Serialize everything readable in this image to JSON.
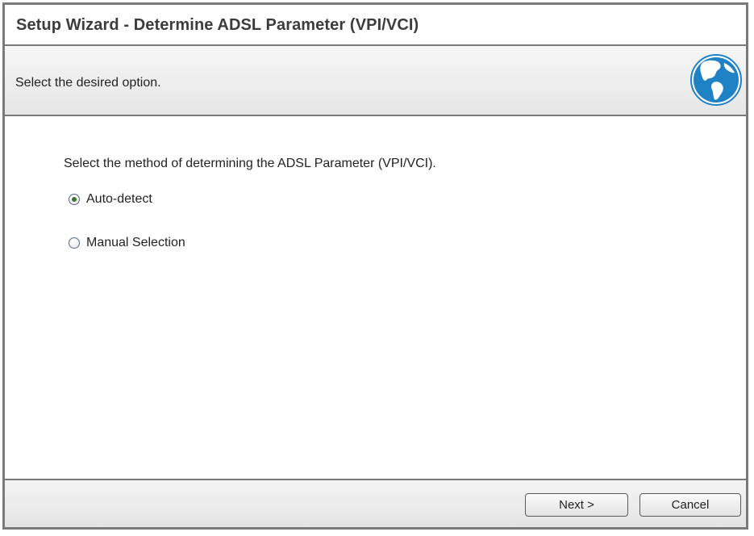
{
  "window": {
    "title": "Setup Wizard - Determine ADSL Parameter (VPI/VCI)"
  },
  "subheader": {
    "text": "Select the desired option.",
    "icon": "globe-icon"
  },
  "content": {
    "instruction": "Select the method of determining the ADSL Parameter (VPI/VCI).",
    "options": [
      {
        "label": "Auto-detect",
        "selected": true
      },
      {
        "label": "Manual Selection",
        "selected": false
      }
    ]
  },
  "footer": {
    "next_label": "Next >",
    "cancel_label": "Cancel"
  },
  "colors": {
    "border": "#7a7a7a",
    "title_text": "#3c3c3c",
    "radio_selected": "#3a7a2a",
    "globe_ocean": "#1e82c4",
    "globe_land": "#ffffff"
  }
}
